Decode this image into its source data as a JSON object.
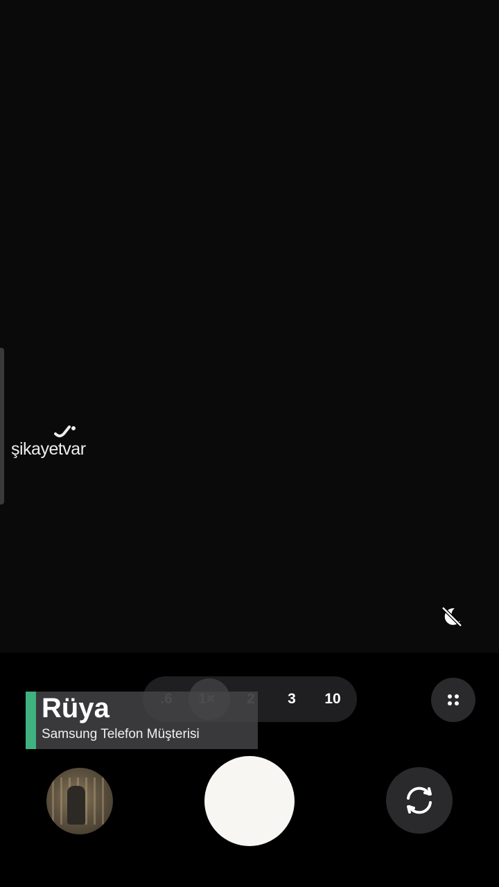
{
  "watermark": {
    "brand": "şikayetvar"
  },
  "zoom": {
    "options": [
      ".6",
      "1×",
      "2",
      "3",
      "10"
    ],
    "selected": "1×"
  },
  "caption": {
    "name": "Rüya",
    "role": "Samsung Telefon Müşterisi"
  },
  "icons": {
    "night_mode": "night-mode-off-icon",
    "grid": "grid-dots-icon",
    "flip": "flip-camera-icon"
  },
  "colors": {
    "accent": "#3fb27f",
    "shutter": "#f7f6f2",
    "background": "#000000"
  }
}
